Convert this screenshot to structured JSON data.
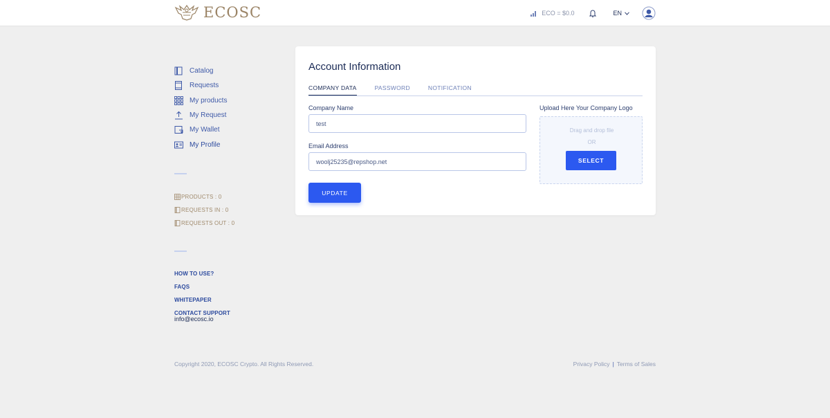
{
  "header": {
    "brand": "ECOSC",
    "rate": "ECO = $0.0",
    "language": "EN"
  },
  "sidebar": {
    "items": [
      {
        "label": "Catalog",
        "icon": "catalog-icon"
      },
      {
        "label": "Requests",
        "icon": "requests-icon"
      },
      {
        "label": "My products",
        "icon": "products-grid-icon"
      },
      {
        "label": "My Request",
        "icon": "upload-request-icon"
      },
      {
        "label": "My Wallet",
        "icon": "wallet-icon"
      },
      {
        "label": "My Profile",
        "icon": "profile-card-icon"
      }
    ],
    "stats": [
      {
        "label": "PRODUCTS : 0"
      },
      {
        "label": "REQUESTS IN : 0"
      },
      {
        "label": "REQUESTS OUT : 0"
      }
    ],
    "links": [
      {
        "label": "HOW TO USE?"
      },
      {
        "label": "FAQS"
      },
      {
        "label": "WHITEPAPER"
      },
      {
        "label": "CONTACT SUPPORT"
      }
    ],
    "support_email": "info@ecosc.io"
  },
  "card": {
    "title": "Account Information",
    "tabs": [
      {
        "label": "COMPANY DATA"
      },
      {
        "label": "PASSWORD"
      },
      {
        "label": "NOTIFICATION"
      }
    ],
    "company_name_label": "Company Name",
    "company_name_value": "test",
    "email_label": "Email Address",
    "email_value": "woolj25235@repshop.net",
    "update_button": "UPDATE",
    "upload_label": "Upload Here Your Company Logo",
    "drop_text": "Drag and drop file",
    "or_text": "OR",
    "select_button": "SELECT"
  },
  "footer": {
    "copyright": "Copyright 2020, ECOSC Crypto. All Rights Reserved.",
    "privacy": "Privacy Policy",
    "separator": "|",
    "terms": "Terms of Sales"
  },
  "colors": {
    "accent": "#2c59f0",
    "brand_gold": "#9b8466",
    "nav_blue": "#3f5aa8",
    "background": "#efefef"
  }
}
